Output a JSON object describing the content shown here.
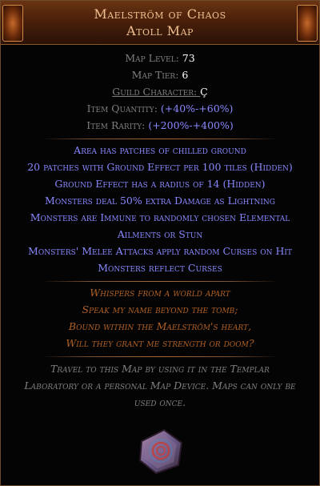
{
  "item": {
    "name": "Maelström of Chaos",
    "base_type": "Atoll Map",
    "rarity_color": "#af6025",
    "properties": [
      {
        "label": "Map Level: ",
        "value": "73"
      },
      {
        "label": "Map Tier: ",
        "value": "6"
      },
      {
        "label": "Guild Character: ",
        "value": "Ç"
      },
      {
        "label": "Item Quantity: ",
        "value": "(+40%-+60%)"
      },
      {
        "label": "Item Rarity: ",
        "value": "(+200%-+400%)"
      }
    ],
    "mods": [
      "Area has patches of chilled ground",
      "20 patches with Ground Effect per 100 tiles (Hidden)",
      "Ground Effect has a radius of 14 (Hidden)",
      "Monsters deal 50% extra Damage as Lightning",
      "Monsters are Immune to randomly chosen Elemental",
      "Ailments or Stun",
      "Monsters' Melee Attacks apply random Curses on Hit",
      "Monsters reflect Curses"
    ],
    "flavour": [
      "Whispers from a world apart",
      "Speak my name beyond the tomb;",
      "Bound within the Maelström's heart,",
      "Will they grant me strength or doom?"
    ],
    "description": [
      "Travel to this Map by using it in the Templar",
      "Laboratory or a personal Map Device. Maps can only be",
      "used once."
    ],
    "icon": "map-item-icon"
  }
}
